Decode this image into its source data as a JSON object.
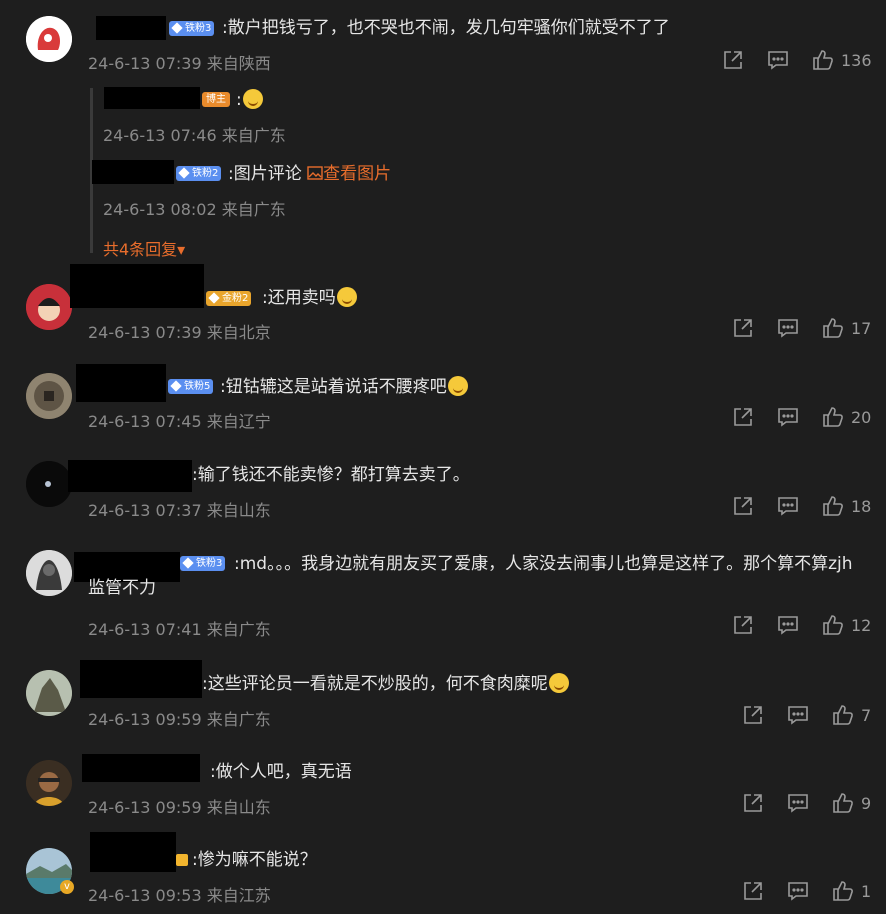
{
  "comments": [
    {
      "badge": "铁粉3",
      "text": ":散户把钱亏了，也不哭也不闹，发几句牢骚你们就受不了了",
      "date": "24-6-13 07:39",
      "location": "来自陕西",
      "likes": "136",
      "replies": [
        {
          "badge": "博主",
          "text": ":",
          "date": "24-6-13 07:46",
          "location": "来自广东"
        },
        {
          "badge": "铁粉2",
          "text": ":图片评论",
          "link": "查看图片",
          "date": "24-6-13 08:02",
          "location": "来自广东"
        }
      ],
      "more_replies": "共4条回复▾"
    },
    {
      "badge": "金粉2",
      "text": ":还用卖吗",
      "date": "24-6-13 07:39",
      "location": "来自北京",
      "likes": "17"
    },
    {
      "badge": "铁粉5",
      "text": ":钮钴辘这是站着说话不腰疼吧",
      "date": "24-6-13 07:45",
      "location": "来自辽宁",
      "likes": "20"
    },
    {
      "badge": "",
      "text": ":输了钱还不能卖惨？都打算去卖了。",
      "date": "24-6-13 07:37",
      "location": "来自山东",
      "likes": "18"
    },
    {
      "badge": "铁粉3",
      "text": ":md。。。我身边就有朋友买了爱康，人家没去闹事儿也算是这样了。那个算不算zjh监管不力",
      "date": "24-6-13 07:41",
      "location": "来自广东",
      "likes": "12"
    },
    {
      "badge": "",
      "text": ":这些评论员一看就是不炒股的，何不食肉糜呢",
      "date": "24-6-13 09:59",
      "location": "来自广东",
      "likes": "7"
    },
    {
      "badge": "",
      "text": ":做个人吧，真无语",
      "date": "24-6-13 09:59",
      "location": "来自山东",
      "likes": "9"
    },
    {
      "badge": "",
      "text": ":惨为嘛不能说？",
      "date": "24-6-13 09:53",
      "location": "来自江苏",
      "likes": "1"
    }
  ]
}
